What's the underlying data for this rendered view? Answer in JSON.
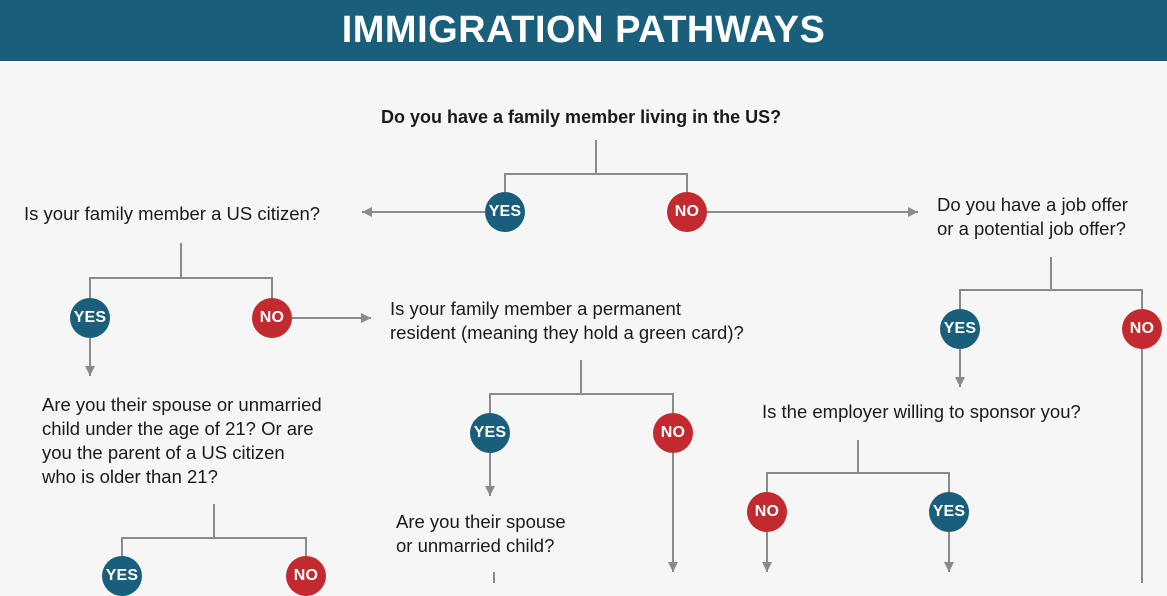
{
  "title": "IMMIGRATION PATHWAYS",
  "colors": {
    "header": "#195e7b",
    "yes": "#195e7b",
    "no": "#c32a2f",
    "connector": "#8a8a8a"
  },
  "questions": {
    "q1": "Do you have a family member living in the US?",
    "q2": "Is your family member a US citizen?",
    "q3_line1": "Do you have a job offer",
    "q3_line2": "or a potential job offer?",
    "q4_line1": "Is your family member a permanent",
    "q4_line2": "resident (meaning they hold a green card)?",
    "q5_line1": "Are you their spouse or unmarried",
    "q5_line2": "child under the age of 21? Or are",
    "q5_line3": "you the parent of a US citizen",
    "q5_line4": "who is older than 21?",
    "q6": "Is the employer willing to sponsor you?",
    "q7_line1": "Are you their spouse",
    "q7_line2": "or unmarried child?"
  },
  "labels": {
    "yes": "YES",
    "no": "NO"
  }
}
